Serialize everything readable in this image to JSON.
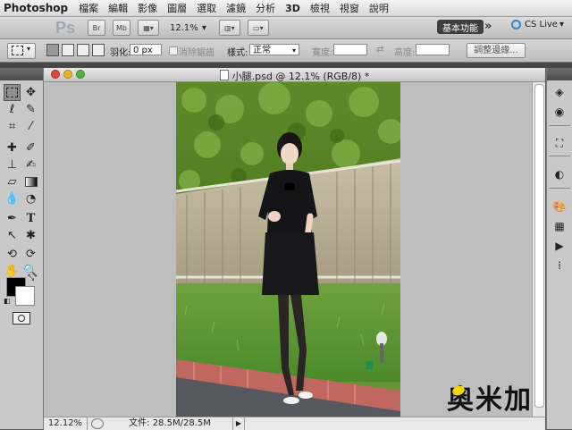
{
  "menubar": {
    "app_name": "Photoshop",
    "items": [
      "檔案",
      "編輯",
      "影像",
      "圖層",
      "選取",
      "濾鏡",
      "分析",
      "3D",
      "檢視",
      "視窗",
      "說明"
    ]
  },
  "appbar": {
    "logo": "Ps",
    "bridge_label": "Br",
    "minibridge_label": "Mb",
    "zoom_value": "12.1%",
    "workspace_label": "基本功能",
    "more_label": "»",
    "cslive_label": "CS Live"
  },
  "options": {
    "feather_label": "羽化:",
    "feather_value": "0 px",
    "antialias_label": "消除鋸齒",
    "style_label": "樣式:",
    "style_value": "正常",
    "width_label": "寬度:",
    "height_label": "高度:",
    "refine_label": "調整邊緣..."
  },
  "document": {
    "title": "小腿.psd @ 12.1% (RGB/8) *",
    "zoom": "12.12%",
    "file_info": "文件: 28.5M/28.5M"
  },
  "watermark": {
    "text": "奥米加"
  },
  "colors": {
    "selected_tool": "#8f8f8f",
    "workspace_button": "#3f3f3f",
    "cslive_accent": "#2a8ad4",
    "foreground": "#000000",
    "background": "#ffffff"
  }
}
